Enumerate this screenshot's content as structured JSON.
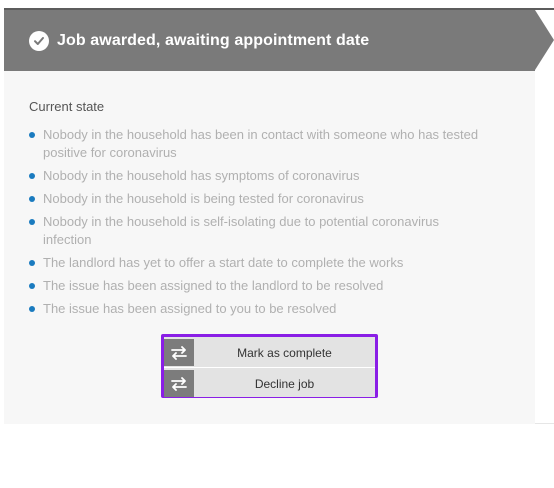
{
  "header": {
    "title": "Job awarded, awaiting appointment date",
    "icon": "check-circle-icon"
  },
  "current_state": {
    "label": "Current state",
    "items": [
      "Nobody in the household has been in contact with someone who has tested positive for coronavirus",
      "Nobody in the household has symptoms of coronavirus",
      "Nobody in the household is being tested for coronavirus",
      "Nobody in the household is self-isolating due to potential coronavirus infection",
      "The landlord has yet to offer a start date to complete the works",
      "The issue has been assigned to the landlord to be resolved",
      "The issue has been assigned to you to be resolved"
    ]
  },
  "actions": {
    "mark_complete_label": "Mark as complete",
    "decline_label": "Decline job",
    "icon": "swap-arrows-icon"
  },
  "colors": {
    "header_bg": "#7a7a7a",
    "bullet": "#1a7bbf",
    "highlight_border": "#8a1ee6"
  }
}
